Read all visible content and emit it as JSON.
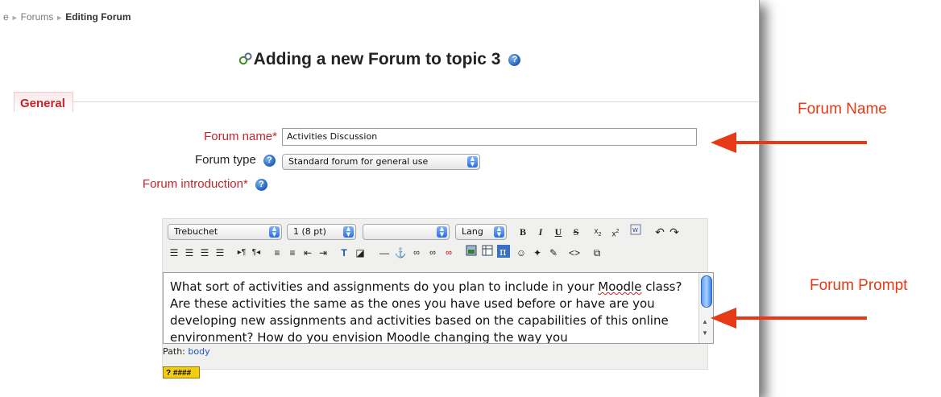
{
  "breadcrumb": {
    "partial": "e",
    "items": [
      "Forums"
    ],
    "current": "Editing Forum"
  },
  "page": {
    "title": "Adding a new Forum to topic 3",
    "help": "?"
  },
  "section": {
    "legend": "General"
  },
  "form": {
    "forum_name_label": "Forum name",
    "forum_name_value": "Activities Discussion",
    "forum_type_label": "Forum type",
    "forum_type_value": "Standard forum for general use",
    "intro_label": "Forum introduction",
    "required_mark": "*"
  },
  "editor": {
    "font_family": "Trebuchet",
    "font_size": "1 (8 pt)",
    "style": "",
    "lang": "Lang",
    "content": "What sort of activities and assignments do you plan to include in your Moodle class?  Are these activities the same as the ones you have used before or have are you developing new assignments and activities based on the capabilities of this online environment?  How do you envision Moodle changing the way you",
    "path_label": "Path:",
    "path_value": "body",
    "badge": "? ####"
  },
  "annotations": {
    "forum_name": "Forum Name",
    "forum_prompt": "Forum Prompt"
  },
  "colors": {
    "required": "#c1272d",
    "annotation": "#e53a15",
    "link": "#1c55b8"
  }
}
